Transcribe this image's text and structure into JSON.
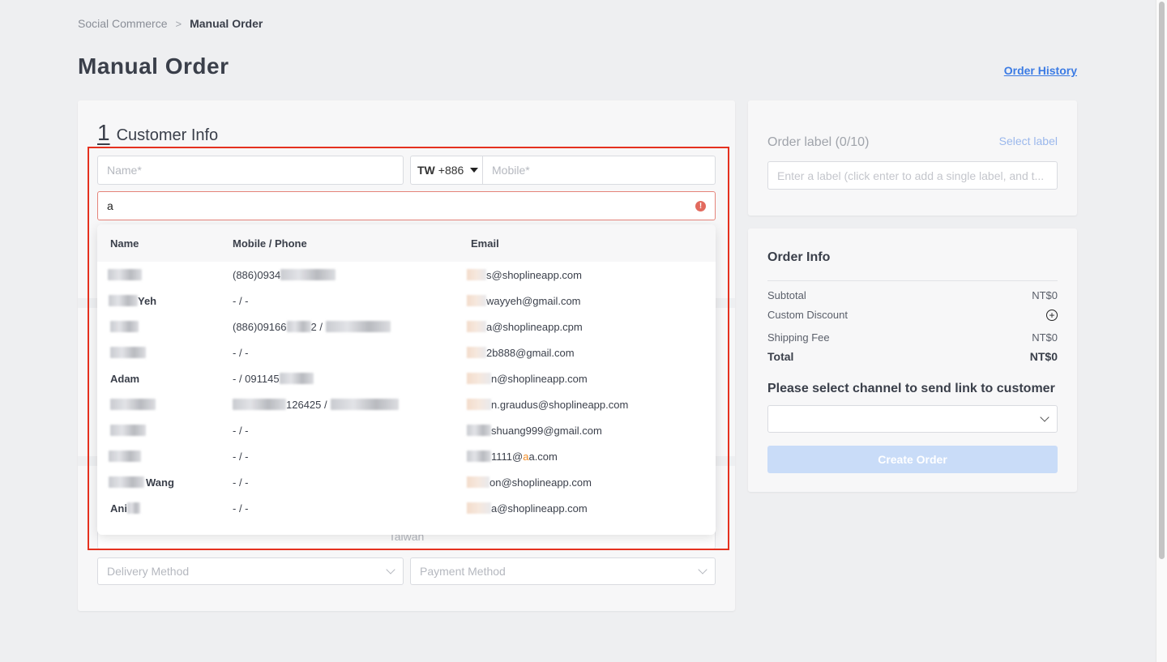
{
  "breadcrumb": {
    "parent": "Social Commerce",
    "separator": ">",
    "current": "Manual Order"
  },
  "page": {
    "title": "Manual Order",
    "order_history_link": "Order History"
  },
  "customer_section": {
    "number": "1",
    "title": "Customer Info",
    "name_placeholder": "Name*",
    "country_code": "TW",
    "dial_code": "+886",
    "mobile_placeholder": "Mobile*",
    "search_value": "a",
    "country_value": "Taiwan",
    "delivery_placeholder": "Delivery Method",
    "payment_placeholder": "Payment Method"
  },
  "customer_dropdown": {
    "headers": {
      "name": "Name",
      "phone": "Mobile / Phone",
      "email": "Email"
    },
    "rows": [
      {
        "name": "",
        "phone": "(886)0934",
        "email": "s@shoplineapp.com"
      },
      {
        "name": "Yeh",
        "phone": "- / -",
        "email": "wayyeh@gmail.com"
      },
      {
        "name": "",
        "phone": "(886)09166",
        "phone_mid": "2 / ",
        "email": "a@shoplineapp.cpm"
      },
      {
        "name": "",
        "phone": "- / -",
        "email": "2b888@gmail.com"
      },
      {
        "name": "Adam",
        "phone": "- / 091145",
        "email": "n@shoplineapp.com"
      },
      {
        "name": "",
        "phone": "126425 / ",
        "email": "n.graudus@shoplineapp.com"
      },
      {
        "name": "",
        "phone": "- / -",
        "email": "shuang999@gmail.com"
      },
      {
        "name": "",
        "phone": "- / -",
        "email_pre": "1111@",
        "email_hl": "a",
        "email": "a.com"
      },
      {
        "name": "Wang",
        "phone": "- / -",
        "email": "on@shoplineapp.com"
      },
      {
        "name": "Ani",
        "phone": "- / -",
        "email": "a@shoplineapp.com"
      }
    ]
  },
  "label_card": {
    "title": "Order label (0/10)",
    "select_link": "Select label",
    "input_placeholder": "Enter a label (click enter to add a single label, and t..."
  },
  "order_info": {
    "title": "Order Info",
    "subtotal_label": "Subtotal",
    "subtotal_value": "NT$0",
    "discount_label": "Custom Discount",
    "shipping_label": "Shipping Fee",
    "shipping_value": "NT$0",
    "total_label": "Total",
    "total_value": "NT$0",
    "channel_title": "Please select channel to send link to customer",
    "create_button": "Create Order"
  },
  "colors": {
    "accent": "#3b7be4",
    "highlight": "#e5311f",
    "error": "#e26a5e",
    "button_disabled": "#c9dcf8"
  }
}
